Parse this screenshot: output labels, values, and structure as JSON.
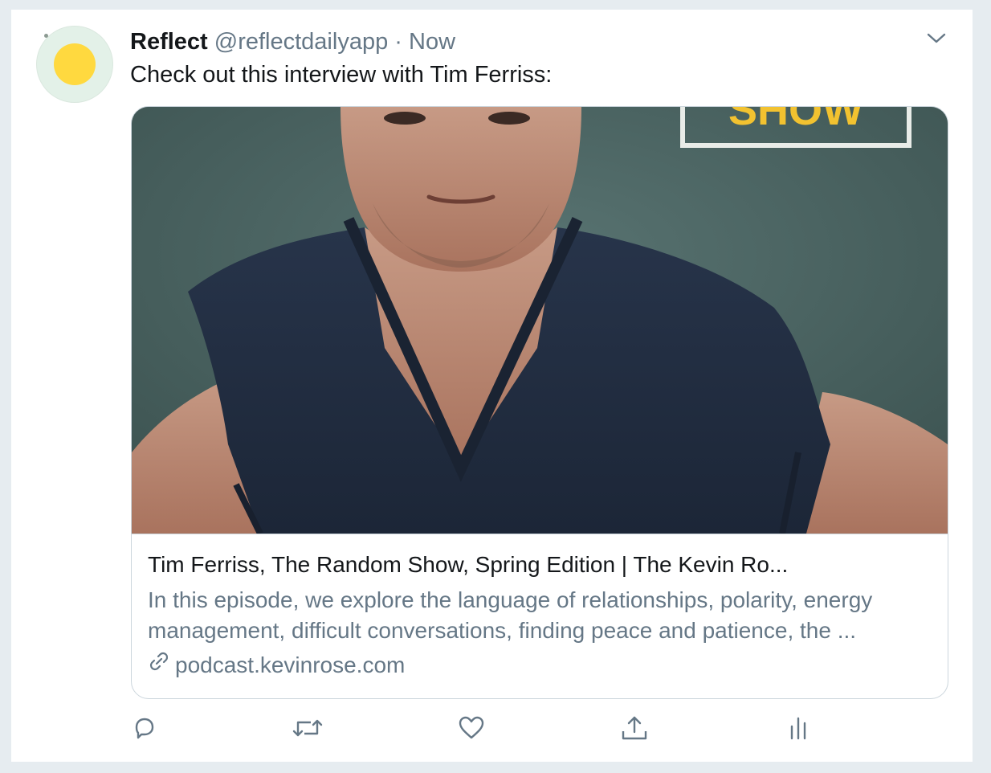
{
  "tweet": {
    "name": "Reflect",
    "handle": "@reflectdailyapp",
    "separator": "·",
    "time": "Now",
    "text": "Check out this interview with Tim Ferriss:"
  },
  "card": {
    "image_alt": "Tim Ferriss in a navy V-neck t-shirt",
    "image_sign_text": "SHOW",
    "title": "Tim Ferriss, The Random Show, Spring Edition | The Kevin Ro...",
    "description": "In this episode, we explore the language of relationships, polarity, energy management, difficult conversations, finding peace and patience, the ...",
    "domain": "podcast.kevinrose.com"
  },
  "actions": {
    "reply": "reply-icon",
    "retweet": "retweet-icon",
    "like": "heart-icon",
    "share": "share-icon",
    "analytics": "analytics-icon"
  },
  "colors": {
    "text_primary": "#14171a",
    "text_secondary": "#657786",
    "border": "#ccd6dd",
    "avatar_bg": "#e3f1e8",
    "avatar_sun": "#ffd93f",
    "sign_yellow": "#f2c230"
  }
}
